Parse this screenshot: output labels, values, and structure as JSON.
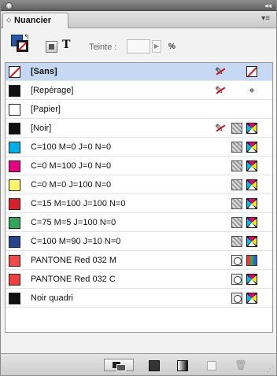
{
  "panel": {
    "title": "Nuancier",
    "collapse_glyph": "◂◂",
    "menu_glyph": "▾≡"
  },
  "toolbar": {
    "text_button": "T",
    "tint_label": "Teinte :",
    "tint_value": "",
    "tint_unit": "%"
  },
  "swatches": [
    {
      "label": "[Sans]",
      "chip": "none",
      "selected": true,
      "icons": [
        "noedit",
        "none-swatch"
      ]
    },
    {
      "label": "[Repérage]",
      "chip": "#111111",
      "icons": [
        "noedit",
        "registration"
      ]
    },
    {
      "label": "[Papier]",
      "chip": "#ffffff",
      "icons": []
    },
    {
      "label": "[Noir]",
      "chip": "#111111",
      "icons": [
        "noedit",
        "process",
        "cmyk"
      ]
    },
    {
      "label": "C=100 M=0 J=0 N=0",
      "chip": "#00aee8",
      "icons": [
        "process",
        "cmyk"
      ]
    },
    {
      "label": "C=0 M=100 J=0 N=0",
      "chip": "#e5007e",
      "icons": [
        "process",
        "cmyk"
      ]
    },
    {
      "label": "C=0 M=0 J=100 N=0",
      "chip": "#fff46a",
      "icons": [
        "process",
        "cmyk"
      ]
    },
    {
      "label": "C=15 M=100 J=100 N=0",
      "chip": "#d4212d",
      "icons": [
        "process",
        "cmyk"
      ]
    },
    {
      "label": "C=75 M=5 J=100 N=0",
      "chip": "#34a55a",
      "icons": [
        "process",
        "cmyk"
      ]
    },
    {
      "label": "C=100 M=90 J=10 N=0",
      "chip": "#27448f",
      "icons": [
        "process",
        "cmyk"
      ]
    },
    {
      "label": "PANTONE Red 032 M",
      "chip": "#ee4a4a",
      "icons": [
        "spot",
        "rgb"
      ]
    },
    {
      "label": "PANTONE Red 032 C",
      "chip": "#ee4040",
      "icons": [
        "spot",
        "cmyk"
      ]
    },
    {
      "label": "Noir quadri",
      "chip": "#111111",
      "icons": [
        "spot",
        "cmyk"
      ]
    }
  ],
  "bottom_bar": {
    "trash_glyph": "🗑"
  }
}
